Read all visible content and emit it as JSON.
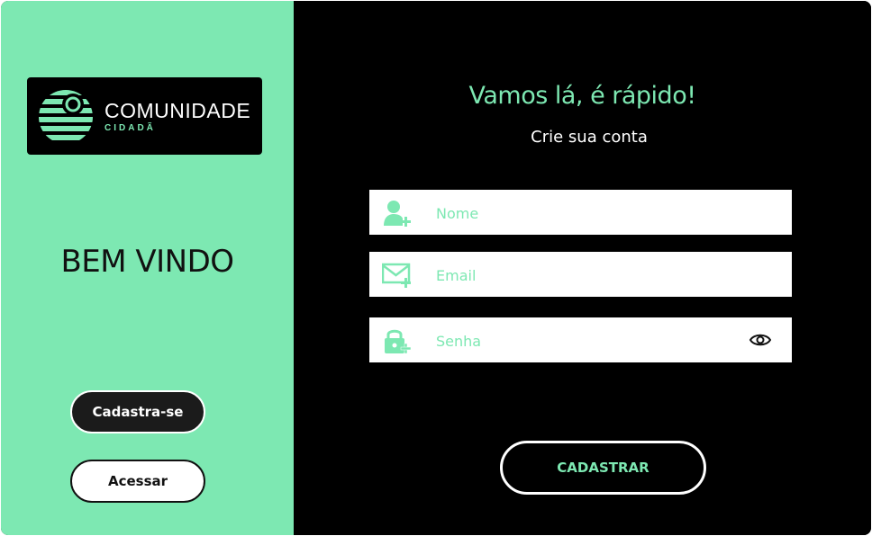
{
  "brand": {
    "name": "COMUNIDADE",
    "tagline": "CIDADÃ"
  },
  "left": {
    "welcome": "BEM VINDO",
    "signup_button": "Cadastra-se",
    "login_button": "Acessar"
  },
  "form": {
    "heading": "Vamos lá, é rápido!",
    "subheading": "Crie sua conta",
    "fields": [
      {
        "placeholder": "Nome",
        "value": "",
        "icon": "add-user-icon"
      },
      {
        "placeholder": "Email",
        "value": "",
        "icon": "add-mail-icon"
      },
      {
        "placeholder": "Senha",
        "value": "",
        "icon": "add-lock-icon"
      }
    ],
    "submit": "CADASTRAR"
  },
  "colors": {
    "accent": "#7de8b2",
    "panel_dark": "#000000",
    "button_dark": "#1b1b1b"
  }
}
